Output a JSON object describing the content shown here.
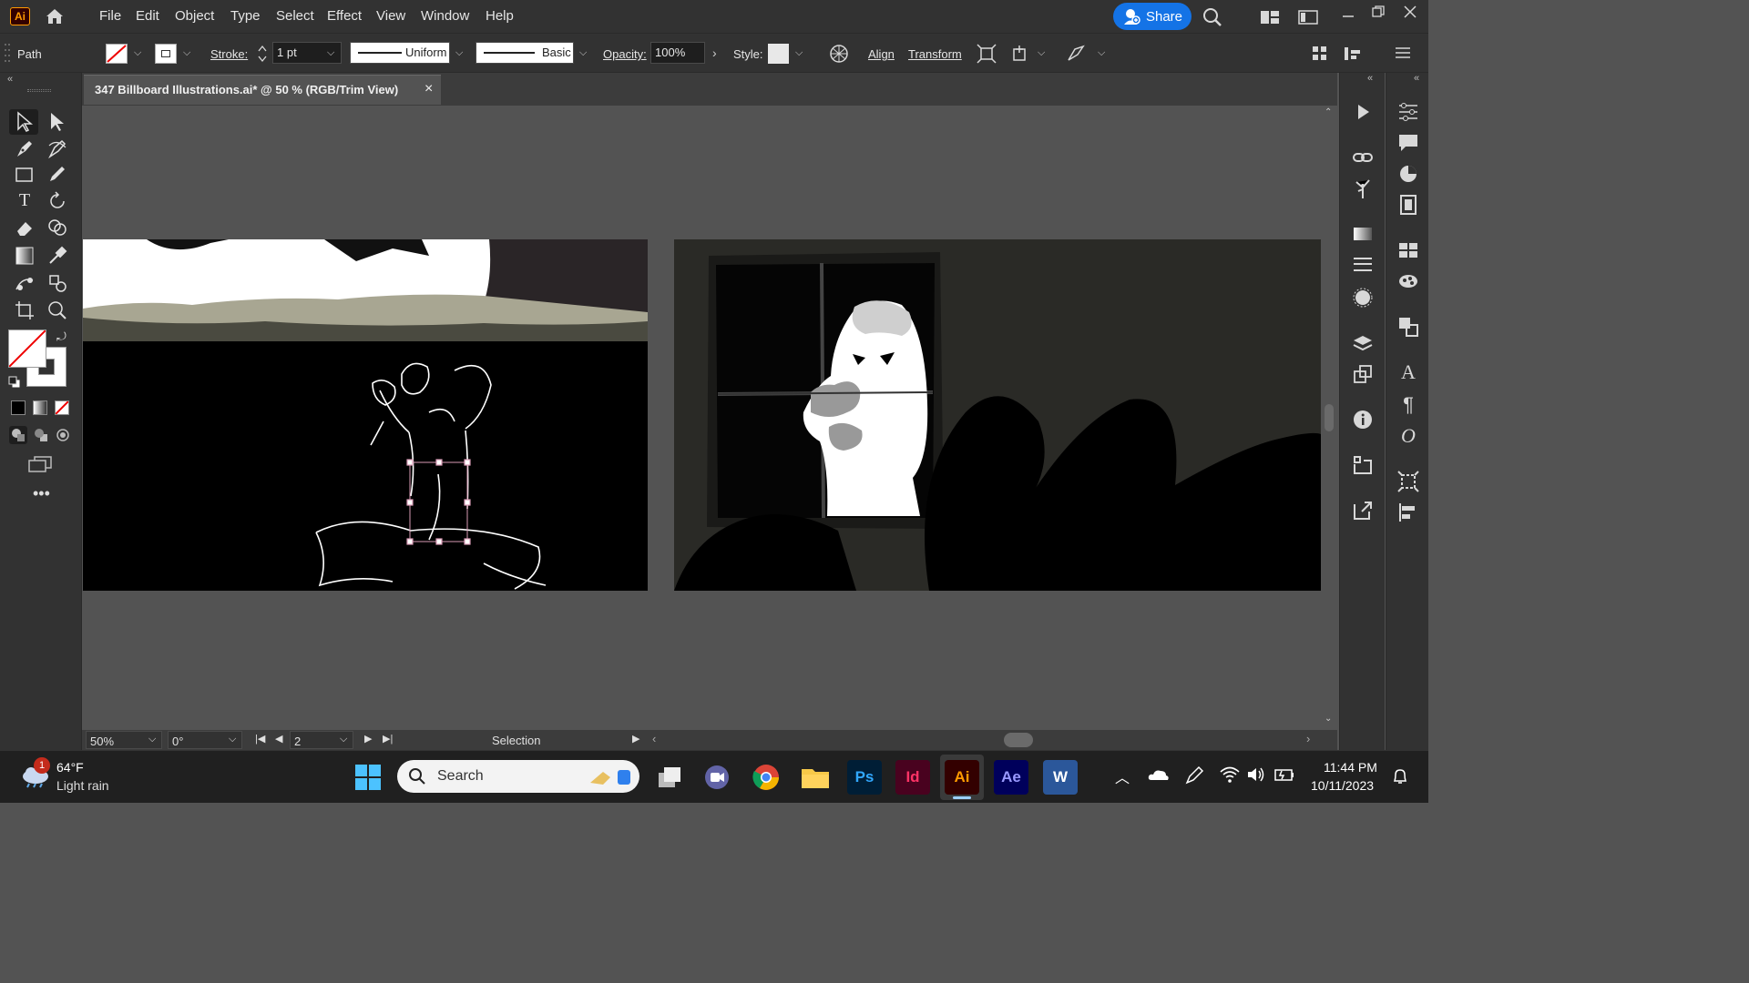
{
  "app": {
    "logo": "Ai"
  },
  "menu": [
    "File",
    "Edit",
    "Object",
    "Type",
    "Select",
    "Effect",
    "View",
    "Window",
    "Help"
  ],
  "share_label": "Share",
  "control": {
    "selection_type": "Path",
    "stroke_label": "Stroke:",
    "stroke_value": "1 pt",
    "profile_label": "Uniform",
    "brush_label": "Basic",
    "opacity_label": "Opacity:",
    "opacity_value": "100%",
    "style_label": "Style:",
    "align_label": "Align",
    "transform_label": "Transform"
  },
  "document_tab": {
    "title": "347 Billboard Illustrations.ai* @ 50 % (RGB/Trim View)",
    "close": "×"
  },
  "status": {
    "zoom": "50%",
    "rotation": "0°",
    "artboard": "2",
    "tool": "Selection"
  },
  "taskbar": {
    "weather_temp": "64°F",
    "weather_desc": "Light rain",
    "weather_badge": "1",
    "search_placeholder": "Search",
    "time": "11:44 PM",
    "date": "10/11/2023",
    "apps": [
      "Ps",
      "Id",
      "Ai",
      "Ae",
      "W"
    ]
  },
  "colors": {
    "accent": "#1473e6",
    "illustrator_orange": "#ff9a00",
    "ps_blue": "#31a8ff",
    "id_pink": "#ff3366",
    "ae_purple": "#9999ff",
    "word_blue": "#2b579a"
  }
}
